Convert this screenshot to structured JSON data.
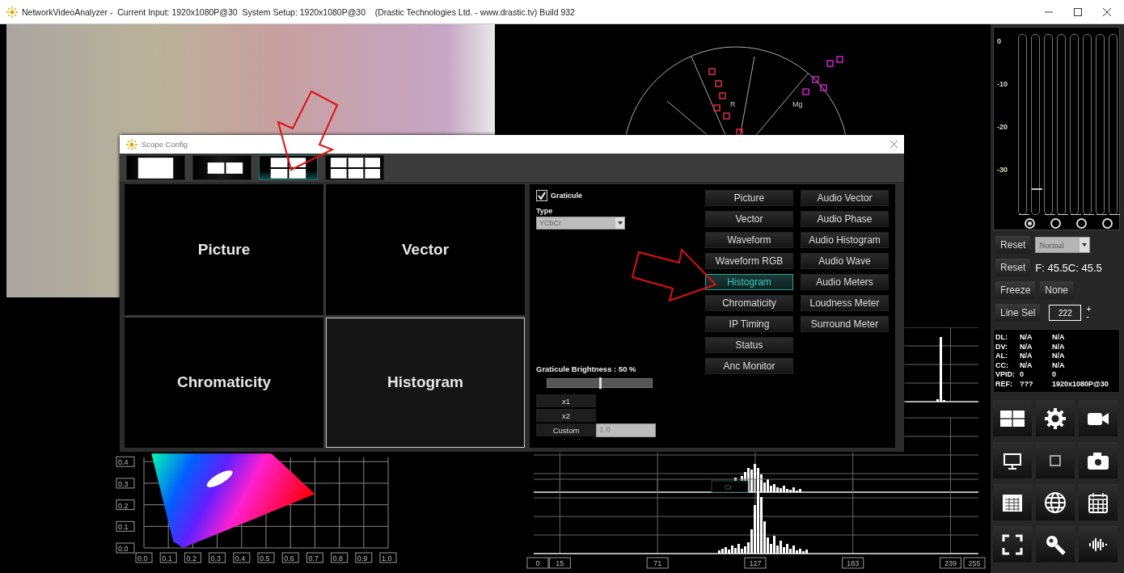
{
  "window": {
    "title": "NetworkVideoAnalyzer -  Current Input: 1920x1080P@30  System Setup: 1920x1080P@30    (Drastic Technologies Ltd. - www.drastic.tv) Build 932"
  },
  "vectorscope": {
    "labels": [
      "R",
      "Mg"
    ]
  },
  "chromaticity": {
    "x_ticks": [
      "0.0",
      "0.1",
      "0.2",
      "0.3",
      "0.4",
      "0.5",
      "0.6",
      "0.7",
      "0.8",
      "0.9",
      "1.0"
    ],
    "y_ticks": [
      "0.4",
      "0.3",
      "0.2",
      "0.1",
      "0.0"
    ]
  },
  "histogram": {
    "channel_label": "Cr",
    "x_ticks": [
      "0",
      "15",
      "71",
      "127",
      "183",
      "239",
      "255"
    ]
  },
  "side_panel": {
    "meter_scale": [
      "0",
      "-10",
      "-20",
      "-30"
    ],
    "meters": [
      {
        "level": 0
      },
      {
        "level": 0.14
      },
      {
        "level": 0
      },
      {
        "level": 0
      },
      {
        "level": 0
      },
      {
        "level": 0
      },
      {
        "level": 0
      },
      {
        "level": 0
      }
    ],
    "meter_selectors": [
      {
        "selected": true
      },
      {
        "selected": false
      },
      {
        "selected": false
      },
      {
        "selected": false
      }
    ],
    "reset_button_1": "Reset",
    "mode_select": "Normal",
    "reset_button_2": "Reset",
    "temperature": "F: 45.5C: 45.5",
    "freeze_button": "Freeze",
    "none_button": "None",
    "line_sel_button": "Line Sel",
    "line_value": "222",
    "spin_up": "+",
    "spin_down": "-",
    "status": [
      {
        "label": "DL:",
        "value_1": "N/A",
        "value_2": "N/A"
      },
      {
        "label": "DV:",
        "value_1": "N/A",
        "value_2": "N/A"
      },
      {
        "label": "AL:",
        "value_1": "N/A",
        "value_2": "N/A"
      },
      {
        "label": "CC:",
        "value_1": "N/A",
        "value_2": "N/A"
      },
      {
        "label": "VPID:",
        "value_1": "0",
        "value_2": "0"
      },
      {
        "label": "REF:",
        "value_1": "???",
        "value_2": "1920x1080P@30"
      }
    ],
    "tools": [
      {
        "kind": "layout"
      },
      {
        "kind": "settings"
      },
      {
        "kind": "stream"
      },
      {
        "kind": "monitor"
      },
      {
        "kind": "square"
      },
      {
        "kind": "camera"
      },
      {
        "kind": "table"
      },
      {
        "kind": "globe"
      },
      {
        "kind": "calendar"
      },
      {
        "kind": "fullscreen"
      },
      {
        "kind": "search"
      },
      {
        "kind": "audio"
      }
    ]
  },
  "dialog": {
    "title": "Scope Config",
    "layouts": [
      {
        "kind": "single",
        "selected": false
      },
      {
        "kind": "dual",
        "selected": false
      },
      {
        "kind": "quad",
        "selected": true
      },
      {
        "kind": "six",
        "selected": false
      }
    ],
    "panes": [
      {
        "label": "Picture",
        "selected": false
      },
      {
        "label": "Vector",
        "selected": false
      },
      {
        "label": "Chromaticity",
        "selected": false
      },
      {
        "label": "Histogram",
        "selected": true
      }
    ],
    "graticule": {
      "label": "Graticule",
      "checked": true
    },
    "type_label": "Type",
    "type_select": "YCbCr",
    "scopes_column_1": [
      {
        "label": "Picture",
        "selected": false
      },
      {
        "label": "Vector",
        "selected": false
      },
      {
        "label": "Waveform",
        "selected": false
      },
      {
        "label": "Waveform RGB",
        "selected": false
      },
      {
        "label": "Histogram",
        "selected": true
      },
      {
        "label": "Chromaticity",
        "selected": false
      },
      {
        "label": "IP Timing",
        "selected": false
      },
      {
        "label": "Status",
        "selected": false
      },
      {
        "label": "Anc Monitor",
        "selected": false
      }
    ],
    "scopes_column_2": [
      {
        "label": "Audio Vector",
        "selected": false
      },
      {
        "label": "Audio Phase",
        "selected": false
      },
      {
        "label": "Audio Histogram",
        "selected": false
      },
      {
        "label": "Audio Wave",
        "selected": false
      },
      {
        "label": "Audio Meters",
        "selected": false
      },
      {
        "label": "Loudness Meter",
        "selected": false
      },
      {
        "label": "Surround Meter",
        "selected": false
      }
    ],
    "brightness_label": "Graticule Brightness : 50 %",
    "brightness": {
      "level": 0.5
    },
    "scale_buttons": [
      "x1",
      "x2",
      "Custom"
    ],
    "custom_value": "1.0"
  }
}
